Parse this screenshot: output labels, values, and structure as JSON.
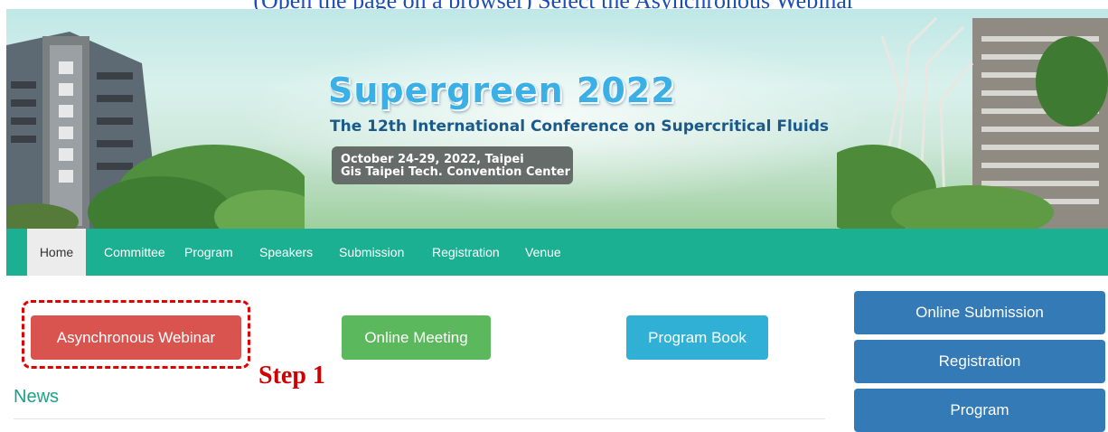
{
  "top_text": "(Open the page on a browser) Select the Asynchronous Webinar",
  "banner": {
    "title": "Supergreen 2022",
    "subtitle": "The 12th International Conference on Supercritical Fluids",
    "date_line1": "October 24-29, 2022, Taipei",
    "date_line2": "Gis Taipei Tech. Convention Center"
  },
  "nav": {
    "items": [
      "Home",
      "Committee",
      "Program",
      "Speakers",
      "Submission",
      "Registration",
      "Venue"
    ],
    "active": "Home"
  },
  "buttons": {
    "async_webinar": "Asynchronous Webinar",
    "online_meeting": "Online Meeting",
    "program_book": "Program Book"
  },
  "annotation": {
    "step": "Step 1"
  },
  "news_heading": "News",
  "sidebar": {
    "online_submission": "Online Submission",
    "registration": "Registration",
    "program": "Program"
  },
  "colors": {
    "nav_bg": "#1bb091",
    "red_button": "#d9534f",
    "green_button": "#5cb85c",
    "cyan_button": "#31b0d5",
    "side_button": "#337ab7",
    "annotation": "#d00000"
  }
}
